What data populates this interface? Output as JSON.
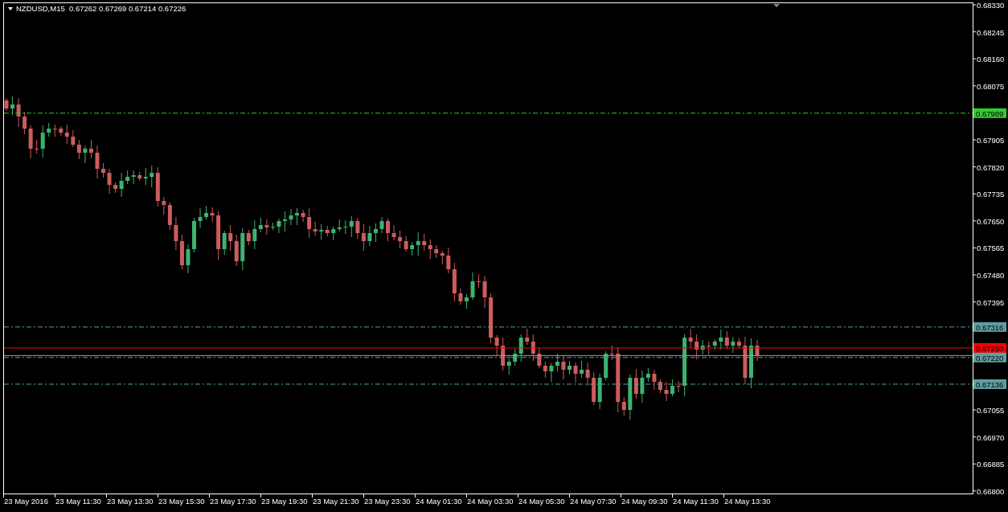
{
  "header": {
    "symbol": "NZDUSD,M15",
    "ohlc": "0.67262 0.67269 0.67214 0.67226"
  },
  "price_axis": [
    "0.68330",
    "0.68245",
    "0.68160",
    "0.68075",
    "0.67905",
    "0.67820",
    "0.67735",
    "0.67650",
    "0.67565",
    "0.67480",
    "0.67395",
    "0.67055",
    "0.66970",
    "0.66885",
    "0.66800"
  ],
  "levels": [
    {
      "price": "0.67989",
      "color": "#32cd32",
      "kind": "dashdot"
    },
    {
      "price": "0.67316",
      "color": "#5f9ea0",
      "kind": "dashdot"
    },
    {
      "price": "0.67250",
      "color": "#ff0000",
      "kind": "solid"
    },
    {
      "price": "0.67220",
      "color": "#5f9ea0",
      "kind": "dashdot"
    },
    {
      "price": "0.67136",
      "color": "#5f9ea0",
      "kind": "dashdot"
    }
  ],
  "time_axis": [
    "23 May 2016",
    "23 May 11:30",
    "23 May 13:30",
    "23 May 15:30",
    "23 May 17:30",
    "23 May 19:30",
    "23 May 21:30",
    "23 May 23:30",
    "24 May 01:30",
    "24 May 03:30",
    "24 May 05:30",
    "24 May 07:30",
    "24 May 09:30",
    "24 May 11:30",
    "24 May 13:30"
  ]
}
